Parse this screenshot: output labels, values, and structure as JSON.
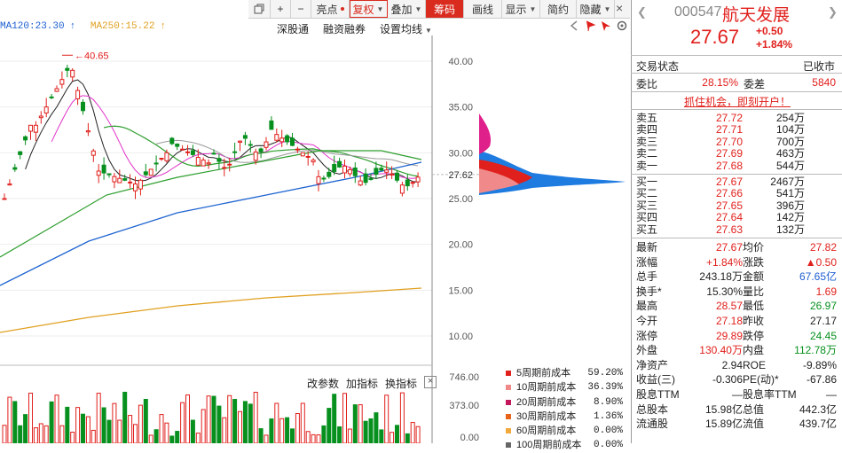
{
  "toolbar": {
    "items": [
      {
        "label": "",
        "icon": "restore-icon"
      },
      {
        "label": "+",
        "icon": "zoom-in-icon"
      },
      {
        "label": "−",
        "icon": "zoom-out-icon"
      },
      {
        "label": "亮点",
        "dot": true
      },
      {
        "label": "复权",
        "caret": true,
        "outlined": true
      },
      {
        "label": "叠加",
        "caret": true
      },
      {
        "label": "筹码",
        "active": true
      },
      {
        "label": "画线"
      },
      {
        "label": "显示",
        "caret": true
      },
      {
        "label": "简约"
      },
      {
        "label": "隐藏",
        "caret": true
      }
    ],
    "close": "×"
  },
  "ma": {
    "ma120": "MA120:23.30",
    "ma250": "MA250:15.22",
    "arrow": "↑"
  },
  "chart_menu": [
    "深股通",
    "融资融券",
    "设置均线"
  ],
  "chart": {
    "high_label": "40.65",
    "axis_ticks": [
      "40.00",
      "35.00",
      "30.00",
      "25.00",
      "20.00",
      "15.00",
      "10.00"
    ],
    "current_price": "27.62",
    "volume_ticks": [
      "746.00",
      "373.00",
      "0.00"
    ]
  },
  "indicator_menu": [
    "改参数",
    "加指标",
    "换指标"
  ],
  "cost_legend": [
    {
      "label": "5周期前成本",
      "pct": "59.20%",
      "color": "#e0201c"
    },
    {
      "label": "10周期前成本",
      "pct": "36.39%",
      "color": "#f08a8a"
    },
    {
      "label": "20周期前成本",
      "pct": "8.90%",
      "color": "#c2185b"
    },
    {
      "label": "30周期前成本",
      "pct": "1.36%",
      "color": "#e8631a"
    },
    {
      "label": "60周期前成本",
      "pct": "0.00%",
      "color": "#f2a93b"
    },
    {
      "label": "100周期前成本",
      "pct": "0.00%",
      "color": "#666666"
    }
  ],
  "stock": {
    "code": "000547",
    "name": "航天发展",
    "price": "27.67",
    "change": "+0.50",
    "change_pct": "+1.84%"
  },
  "status": {
    "label": "交易状态",
    "value": "已收市"
  },
  "webi": {
    "label1": "委比",
    "v1": "28.15%",
    "label2": "委差",
    "v2": "5840"
  },
  "promo": "抓住机会，即刻开户！",
  "asks": [
    {
      "label": "卖五",
      "price": "27.72",
      "vol": "254万"
    },
    {
      "label": "卖四",
      "price": "27.71",
      "vol": "104万"
    },
    {
      "label": "卖三",
      "price": "27.70",
      "vol": "700万"
    },
    {
      "label": "卖二",
      "price": "27.69",
      "vol": "463万"
    },
    {
      "label": "卖一",
      "price": "27.68",
      "vol": "544万"
    }
  ],
  "bids": [
    {
      "label": "买一",
      "price": "27.67",
      "vol": "2467万"
    },
    {
      "label": "买二",
      "price": "27.66",
      "vol": "541万"
    },
    {
      "label": "买三",
      "price": "27.65",
      "vol": "396万"
    },
    {
      "label": "买四",
      "price": "27.64",
      "vol": "142万"
    },
    {
      "label": "买五",
      "price": "27.63",
      "vol": "132万"
    }
  ],
  "quote": [
    {
      "l1": "最新",
      "v1": "27.67",
      "c1": "red",
      "l2": "均价",
      "v2": "27.82",
      "c2": "red"
    },
    {
      "l1": "涨幅",
      "v1": "+1.84%",
      "c1": "red",
      "l2": "涨跌",
      "v2": "▲0.50",
      "c2": "red"
    },
    {
      "l1": "总手",
      "v1": "243.18万",
      "c1": "",
      "l2": "金额",
      "v2": "67.65亿",
      "c2": "blue"
    },
    {
      "l1": "换手*",
      "v1": "15.30%",
      "c1": "",
      "l2": "量比",
      "v2": "1.69",
      "c2": "red"
    },
    {
      "l1": "最高",
      "v1": "28.57",
      "c1": "red",
      "l2": "最低",
      "v2": "26.97",
      "c2": "green"
    },
    {
      "l1": "今开",
      "v1": "27.18",
      "c1": "red",
      "l2": "昨收",
      "v2": "27.17",
      "c2": ""
    },
    {
      "l1": "涨停",
      "v1": "29.89",
      "c1": "red",
      "l2": "跌停",
      "v2": "24.45",
      "c2": "green"
    },
    {
      "l1": "外盘",
      "v1": "130.40万",
      "c1": "red",
      "l2": "内盘",
      "v2": "112.78万",
      "c2": "green"
    },
    {
      "l1": "净资产",
      "v1": "2.94",
      "c1": "",
      "l2": "ROE",
      "v2": "-9.89%",
      "c2": ""
    },
    {
      "l1": "收益(三)",
      "v1": "-0.306",
      "c1": "",
      "l2": "PE(动)*",
      "v2": "-67.86",
      "c2": ""
    },
    {
      "l1": "股息TTM",
      "v1": "—",
      "c1": "",
      "l2": "股息率TTM",
      "v2": "—",
      "c2": ""
    },
    {
      "l1": "总股本",
      "v1": "15.98亿",
      "c1": "",
      "l2": "总值",
      "v2": "442.3亿",
      "c2": ""
    },
    {
      "l1": "流通股",
      "v1": "15.89亿",
      "c1": "",
      "l2": "流值",
      "v2": "439.7亿",
      "c2": ""
    }
  ]
}
